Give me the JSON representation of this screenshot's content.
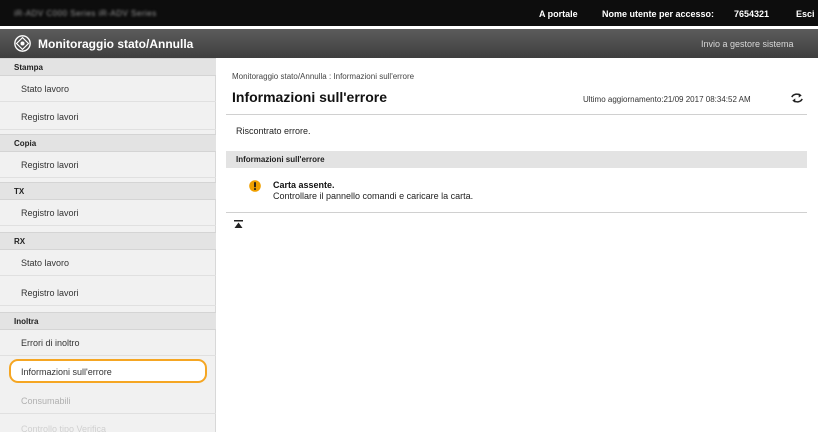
{
  "topbar": {
    "model": "iR-ADV C000 Series iR-ADV Series",
    "portal": "A portale",
    "user_label": "Nome utente per accesso:",
    "user_id": "7654321",
    "logout": "Esci"
  },
  "header": {
    "title": "Monitoraggio stato/Annulla",
    "send_manager": "Invio a gestore sistema"
  },
  "sidebar": {
    "sections": [
      {
        "label": "Stampa",
        "items": [
          "Stato lavoro",
          "Registro lavori"
        ]
      },
      {
        "label": "Copia",
        "items": [
          "Registro lavori"
        ]
      },
      {
        "label": "TX",
        "items": [
          "Registro lavori"
        ]
      },
      {
        "label": "RX",
        "items": [
          "Stato lavoro",
          "Registro lavori"
        ]
      },
      {
        "label": "Inoltra",
        "items": [
          "Errori di inoltro",
          "Informazioni sull'errore",
          "Consumabili",
          "Controllo tipo Verifica"
        ]
      }
    ],
    "selected": "Informazioni sull'errore"
  },
  "main": {
    "breadcrumb": "Monitoraggio stato/Annulla : Informazioni sull'errore",
    "title": "Informazioni sull'errore",
    "last_updated": "Ultimo aggiornamento:21/09 2017 08:34:52 AM",
    "message": "Riscontrato errore.",
    "info_header": "Informazioni sull'errore",
    "error_title": "Carta assente.",
    "error_desc": "Controllare il pannello comandi e caricare la carta."
  },
  "colors": {
    "topbar": "#0d0d0d",
    "titlebar": "#4a4a4a",
    "selection_outline": "#f5a623",
    "warning": "#f0a000"
  }
}
